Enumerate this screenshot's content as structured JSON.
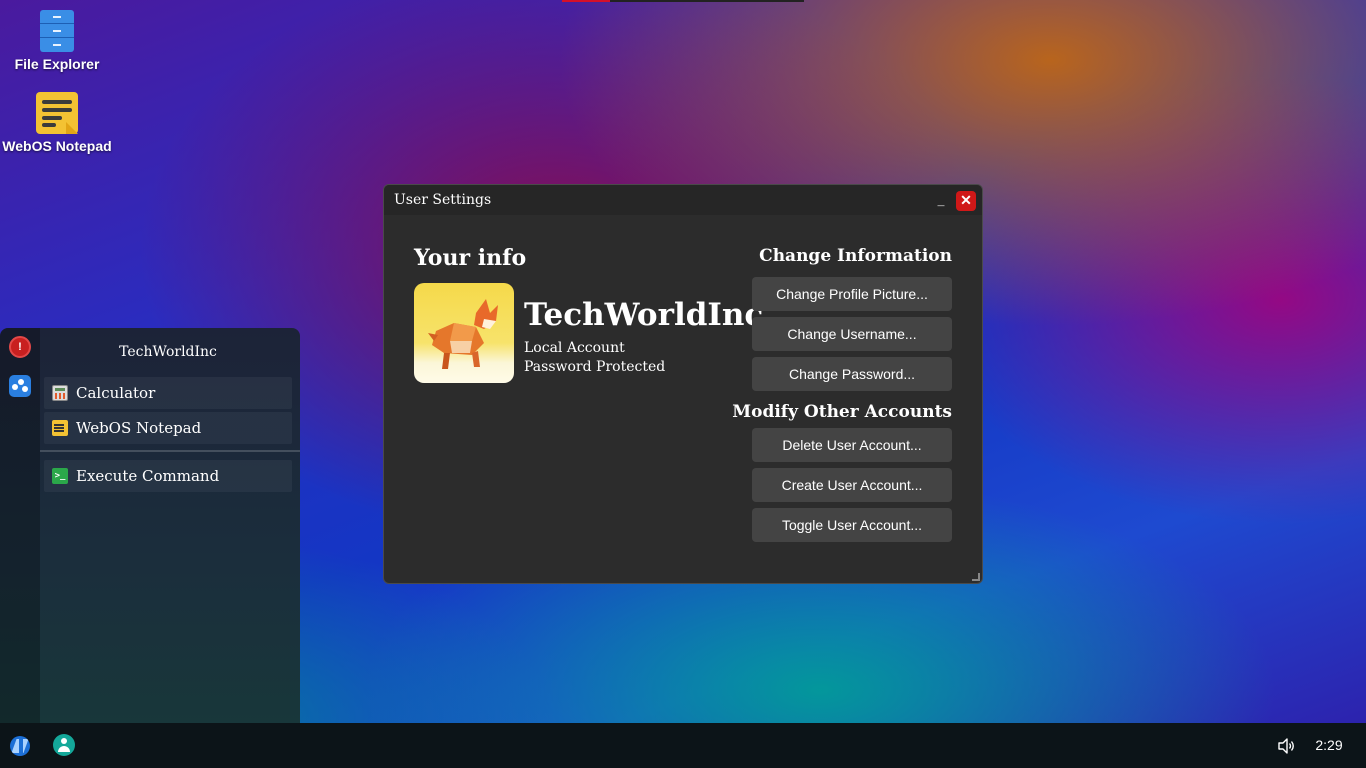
{
  "desktop": {
    "icons": [
      {
        "label": "File Explorer"
      },
      {
        "label": "WebOS Notepad"
      }
    ]
  },
  "start_menu": {
    "username": "TechWorldInc",
    "items": [
      {
        "label": "Calculator"
      },
      {
        "label": "WebOS Notepad"
      },
      {
        "label": "Execute Command"
      }
    ]
  },
  "window": {
    "title": "User Settings",
    "your_info": {
      "heading": "Your info",
      "display_name": "TechWorldInc",
      "account_type": "Local Account",
      "security": "Password Protected"
    },
    "change_information": {
      "heading": "Change Information",
      "buttons": [
        "Change Profile Picture...",
        "Change Username...",
        "Change Password..."
      ]
    },
    "modify_accounts": {
      "heading": "Modify Other Accounts",
      "buttons": [
        "Delete User Account...",
        "Create User Account...",
        "Toggle User Account..."
      ]
    }
  },
  "taskbar": {
    "clock": "2:29"
  },
  "colors": {
    "close_button": "#d01818",
    "window_bg": "#2c2c2c",
    "button_bg": "#444444"
  }
}
